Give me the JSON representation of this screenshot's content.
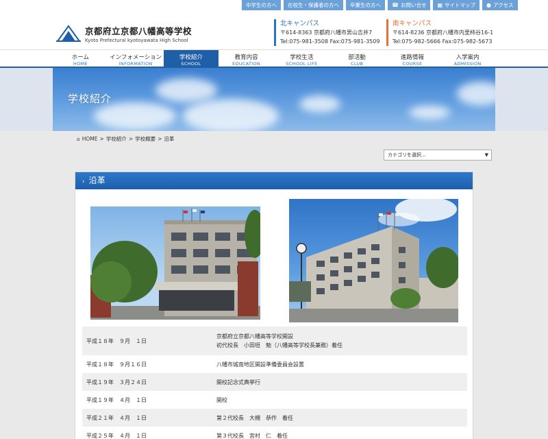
{
  "utility_links": [
    {
      "label": "中学生の方へ",
      "icon": ""
    },
    {
      "label": "在校生・保護者の方へ",
      "icon": ""
    },
    {
      "label": "卒業生の方へ",
      "icon": ""
    },
    {
      "label": "お問い合せ",
      "icon": "phone-icon"
    },
    {
      "label": "サイトマップ",
      "icon": "sitemap-icon"
    },
    {
      "label": "アクセス",
      "icon": "map-pin-icon"
    }
  ],
  "logo": {
    "ja": "京都府立京都八幡高等学校",
    "en": "Kyoto Prefectural kyotoyawata High School"
  },
  "campuses": {
    "north": {
      "title": "北キャンパス",
      "address": "〒614-8363 京都府八幡市男山吉井7",
      "tel": "Tel:075-981-3508 Fax:075-981-3509"
    },
    "south": {
      "title": "南キャンパス",
      "address": "〒614-8236 京都府八幡市内里柿谷16-1",
      "tel": "Tel:075-982-5666 Fax:075-982-5673"
    }
  },
  "nav": [
    {
      "ja": "ホーム",
      "en": "HOME"
    },
    {
      "ja": "インフォメーション",
      "en": "INFORMATION"
    },
    {
      "ja": "学校紹介",
      "en": "SCHOOL"
    },
    {
      "ja": "教育内容",
      "en": "EDUCATION"
    },
    {
      "ja": "学校生活",
      "en": "SCHOOL LIFE"
    },
    {
      "ja": "部活動",
      "en": "CLUB"
    },
    {
      "ja": "進路情報",
      "en": "COURSE"
    },
    {
      "ja": "入学案内",
      "en": "ADMISSION"
    }
  ],
  "hero": {
    "title": "学校紹介"
  },
  "breadcrumb": {
    "home": "HOME",
    "sep": ">",
    "items": [
      "学校紹介",
      "学校概要",
      "沿革"
    ]
  },
  "category_select": {
    "value": "カテゴリを選択..."
  },
  "section": {
    "title": "沿革"
  },
  "history": [
    {
      "date": "平成１８年　９月　１日",
      "line1": "京都府立京都八幡高等学校開設",
      "line2": "初代校長　小田垣　勉（八幡高等学校長兼務）着任"
    },
    {
      "date": "平成１８年　９月１６日",
      "line1": "八幡市城南地区開設準備委員会設置",
      "line2": ""
    },
    {
      "date": "平成１９年　３月２４日",
      "line1": "開校記念式典挙行",
      "line2": ""
    },
    {
      "date": "平成１９年　４月　１日",
      "line1": "開校",
      "line2": ""
    },
    {
      "date": "平成２１年　４月　１日",
      "line1": "第２代校長　大槻　恭作　着任",
      "line2": ""
    },
    {
      "date": "平成２５年　４月　１日",
      "line1": "第３代校長　宮村　仁　着任",
      "line2": ""
    }
  ]
}
